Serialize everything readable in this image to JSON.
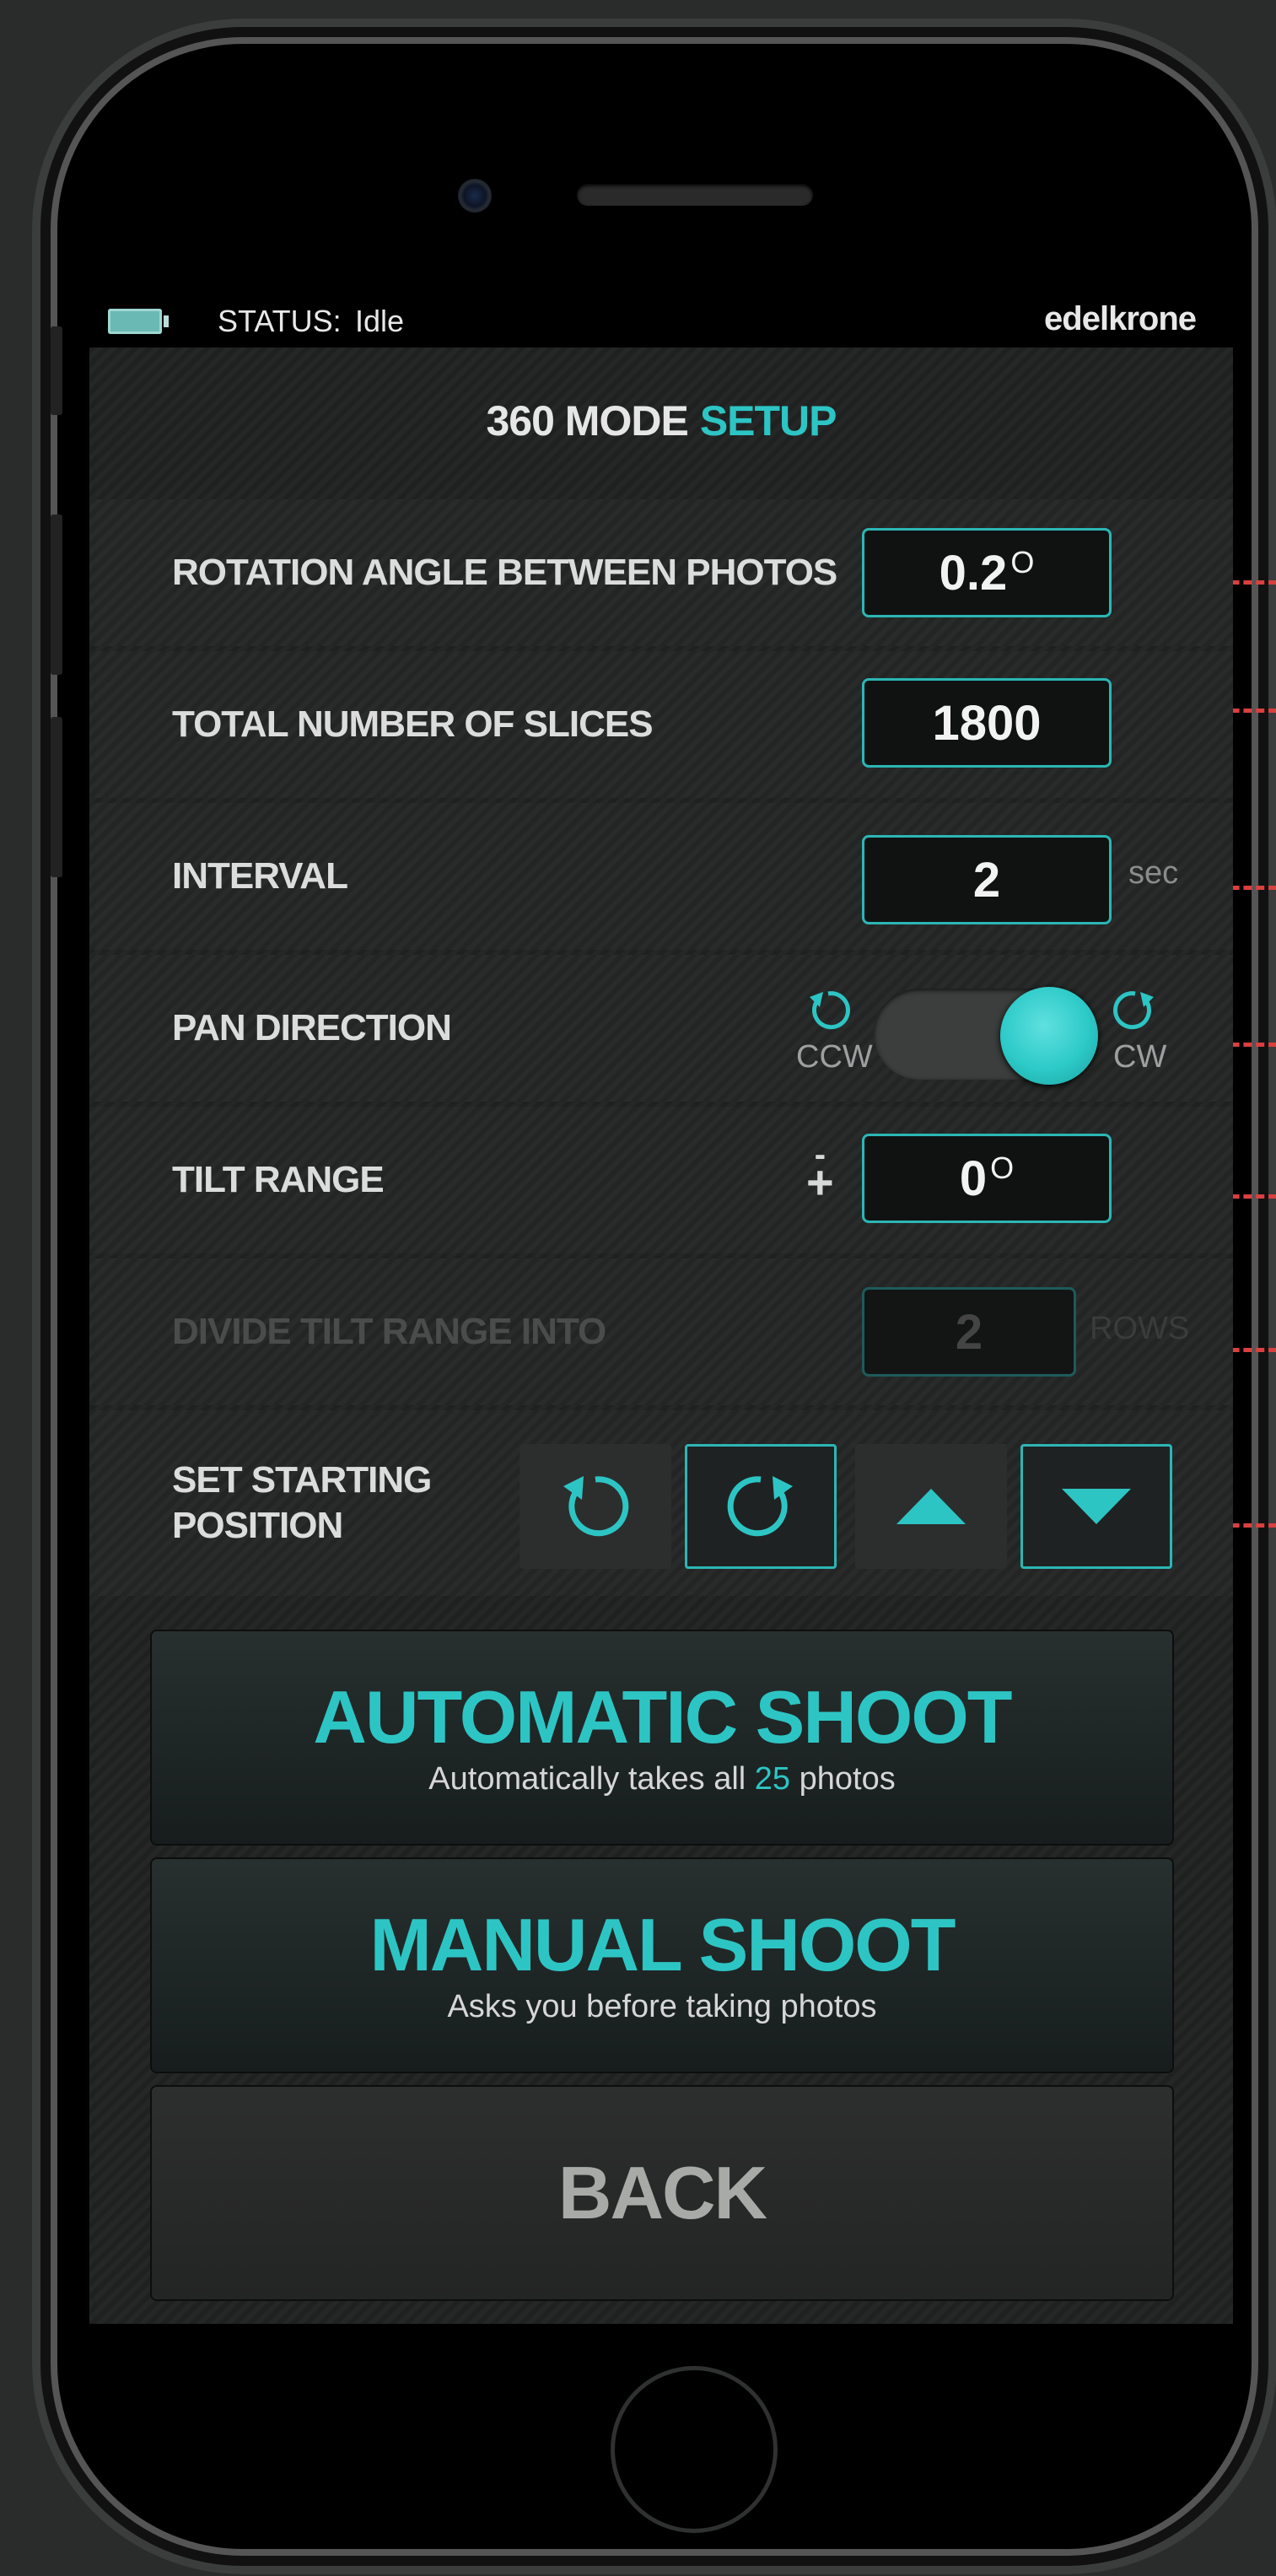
{
  "status_bar": {
    "status_label": "STATUS:",
    "status_value": "Idle",
    "brand": "edelkrone"
  },
  "header": {
    "title_part1": "360 MODE",
    "title_part2": "SETUP"
  },
  "settings": {
    "rotation_angle": {
      "label": "ROTATION ANGLE BETWEEN PHOTOS",
      "value": "0.2",
      "unit_symbol": "O"
    },
    "total_slices": {
      "label": "TOTAL NUMBER OF SLICES",
      "value": "1800"
    },
    "interval": {
      "label": "INTERVAL",
      "value": "2",
      "unit": "sec"
    },
    "pan_direction": {
      "label": "PAN DIRECTION",
      "left_label": "CCW",
      "right_label": "CW",
      "selected": "CW"
    },
    "tilt_range": {
      "label": "TILT RANGE",
      "value": "0",
      "unit_symbol": "O"
    },
    "divide_tilt": {
      "label": "DIVIDE TILT RANGE INTO",
      "value": "2",
      "unit": "ROWS",
      "disabled": true
    },
    "starting_position": {
      "label_line1": "SET STARTING",
      "label_line2": "POSITION"
    }
  },
  "actions": {
    "automatic": {
      "label": "AUTOMATIC SHOOT",
      "sub_before": "Automatically takes all",
      "count": "25",
      "sub_after": "photos"
    },
    "manual": {
      "label": "MANUAL SHOOT",
      "sub": "Asks you before taking photos"
    },
    "back": {
      "label": "BACK"
    }
  },
  "icons": {
    "battery": "battery-icon",
    "ccw": "rotate-ccw-icon",
    "cw": "rotate-cw-icon",
    "up": "triangle-up-icon",
    "down": "triangle-down-icon"
  },
  "colors": {
    "accent": "#2dc5c4",
    "marker": "#d9403e",
    "background": "#2a2c2b"
  }
}
